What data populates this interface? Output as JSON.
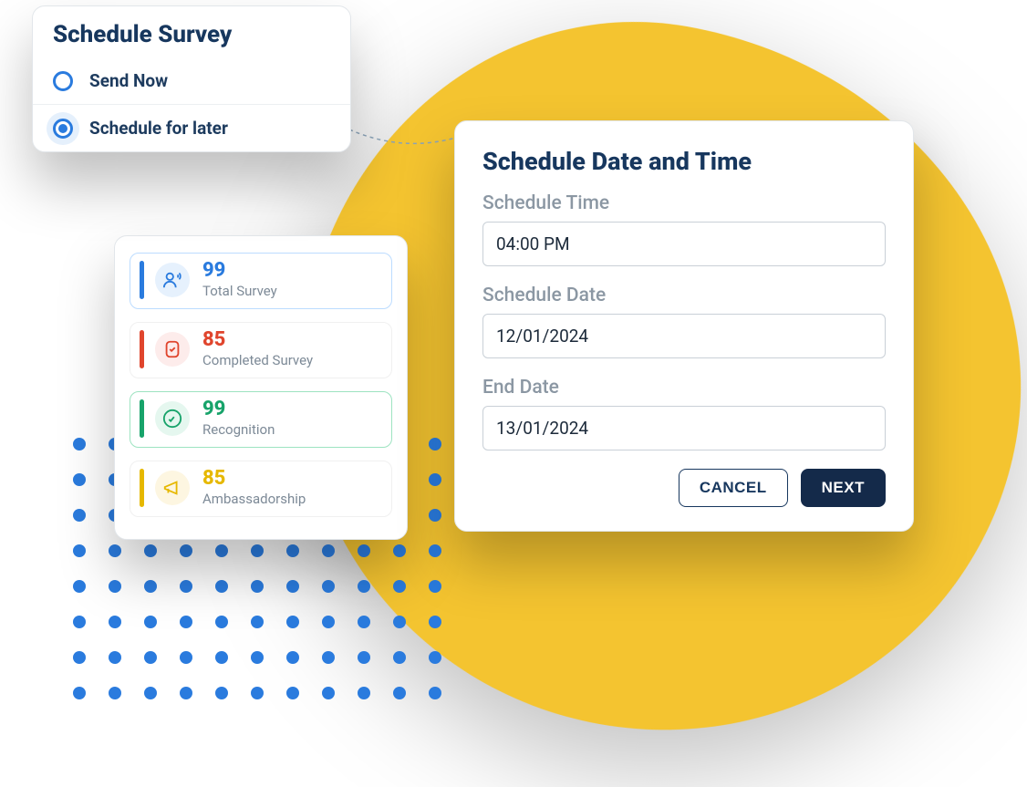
{
  "schedule_survey": {
    "title": "Schedule Survey",
    "options": [
      {
        "label": "Send Now",
        "selected": false
      },
      {
        "label": "Schedule for later",
        "selected": true
      }
    ]
  },
  "stats": [
    {
      "value": "99",
      "label": "Total Survey",
      "color": "blue",
      "icon": "people-icon"
    },
    {
      "value": "85",
      "label": "Completed Survey",
      "color": "red",
      "icon": "checklist-icon"
    },
    {
      "value": "99",
      "label": "Recognition",
      "color": "green",
      "icon": "thumbs-up-icon"
    },
    {
      "value": "85",
      "label": "Ambassadorship",
      "color": "gold",
      "icon": "megaphone-icon"
    }
  ],
  "schedule_form": {
    "heading": "Schedule Date and Time",
    "fields": {
      "time": {
        "label": "Schedule Time",
        "value": "04:00 PM"
      },
      "date": {
        "label": "Schedule Date",
        "value": "12/01/2024"
      },
      "end": {
        "label": "End Date",
        "value": "13/01/2024"
      }
    },
    "buttons": {
      "cancel": "CANCEL",
      "next": "NEXT"
    }
  },
  "colors": {
    "accent_blue": "#2a7bde",
    "accent_red": "#e0452d",
    "accent_green": "#17a36a",
    "accent_gold": "#e6b800",
    "navy": "#17375e",
    "yellow_bg": "#f4c430"
  }
}
